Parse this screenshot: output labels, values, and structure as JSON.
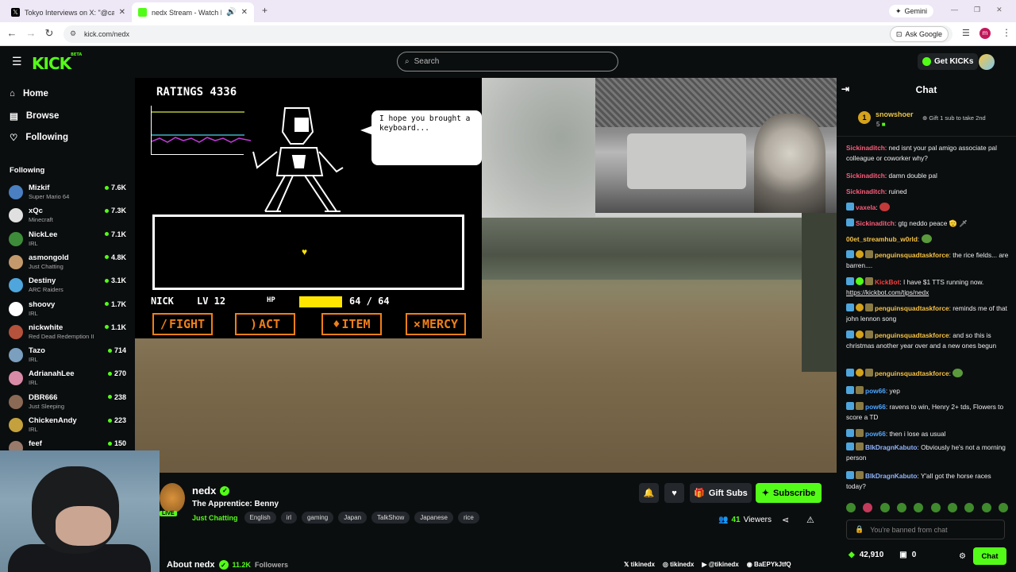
{
  "browser": {
    "tabs": [
      {
        "title": "Tokyo Interviews on X: \"@calli",
        "active": false
      },
      {
        "title": "nedx Stream - Watch Live o",
        "active": true
      }
    ],
    "new_tab": "+",
    "gemini": "Gemini",
    "url": "kick.com/nedx",
    "ask_google": "Ask Google",
    "profile_initial": "m"
  },
  "kick": {
    "logo": "KICK",
    "logo_badge": "BETA",
    "search_placeholder": "Search",
    "get_kicks": "Get KICKs",
    "brand_color": "#53fc18"
  },
  "sidebar": {
    "nav": [
      {
        "label": "Home",
        "icon": "home-icon"
      },
      {
        "label": "Browse",
        "icon": "browse-icon"
      },
      {
        "label": "Following",
        "icon": "heart-icon"
      }
    ],
    "following_title": "Following",
    "channels": [
      {
        "name": "Mizkif",
        "category": "Super Mario 64",
        "viewers": "7.6K",
        "color": "#4a7fc1"
      },
      {
        "name": "xQc",
        "category": "Minecraft",
        "viewers": "7.3K",
        "color": "#e0e0e0"
      },
      {
        "name": "NickLee",
        "category": "IRL",
        "viewers": "7.1K",
        "color": "#3d8c3a"
      },
      {
        "name": "asmongold",
        "category": "Just Chatting",
        "viewers": "4.8K",
        "color": "#c49a6c"
      },
      {
        "name": "Destiny",
        "category": "ARC Raiders",
        "viewers": "3.1K",
        "color": "#4ea6dc"
      },
      {
        "name": "shoovy",
        "category": "IRL",
        "viewers": "1.7K",
        "color": "#ffffff"
      },
      {
        "name": "nickwhite",
        "category": "Red Dead Redemption II",
        "viewers": "1.1K",
        "color": "#b5523c"
      },
      {
        "name": "Tazo",
        "category": "IRL",
        "viewers": "714",
        "color": "#7a9fbf"
      },
      {
        "name": "AdrianahLee",
        "category": "IRL",
        "viewers": "270",
        "color": "#d98aa6"
      },
      {
        "name": "DBR666",
        "category": "Just Sleeping",
        "viewers": "238",
        "color": "#8a6a55"
      },
      {
        "name": "ChickenAndy",
        "category": "IRL",
        "viewers": "223",
        "color": "#c4a13c"
      },
      {
        "name": "feef",
        "category": "",
        "viewers": "150",
        "color": "#9a7a6a"
      }
    ]
  },
  "game": {
    "ratings": "RATINGS 4336",
    "speech": "I hope you brought a keyboard...",
    "player_name": "NICK",
    "level": "LV 12",
    "hp_label": "HP",
    "hp_value": "64 / 64",
    "hp_fraction": 1.0,
    "buttons": [
      "FIGHT",
      "ACT",
      "ITEM",
      "MERCY"
    ]
  },
  "stream": {
    "channel_name": "nedx",
    "live_label": "LIVE",
    "title": "The Apprentice: Benny",
    "category": "Just Chatting",
    "tags": [
      "English",
      "irl",
      "gaming",
      "Japan",
      "TalkShow",
      "Japanese",
      "rice"
    ],
    "gift_subs": "Gift Subs",
    "subscribe": "Subscribe",
    "viewer_count": "41",
    "viewers_label": "Viewers",
    "about": "About nedx",
    "followers_count": "11.2K",
    "followers_label": "Followers",
    "socials": [
      "tikinedx",
      "tikinedx",
      "@tikinedx",
      "BaEPYkJtfQ"
    ]
  },
  "chat": {
    "title": "Chat",
    "pinned": {
      "rank": "1",
      "name": "snowshoer",
      "count": "5",
      "gift_text": "Gift 1 sub to take 2nd"
    },
    "messages": [
      {
        "user": "Sickinaditch",
        "color": "#ff5b7a",
        "text": "ned isnt your pal amigo associate pal colleague or coworker why?"
      },
      {
        "user": "Sickinaditch",
        "color": "#ff5b7a",
        "text": "damn double pal"
      },
      {
        "user": "Sickinaditch",
        "color": "#ff5b7a",
        "text": "ruined"
      },
      {
        "user": "vaxela",
        "color": "#ff5b7a",
        "text": ""
      },
      {
        "user": "Sickinaditch",
        "color": "#ff5b7a",
        "text": "gtg neddo peace 🫡 🗡"
      },
      {
        "user": "00et_streamhub_w0rld",
        "color": "#f6c244",
        "text": ""
      },
      {
        "user": "penguinsquadtaskforce",
        "color": "#f6c244",
        "text": "the rice fields... are barren...."
      },
      {
        "user": "KickBot",
        "color": "#ff3d3d",
        "text": "I have $1 TTS running now.",
        "link": "https://kickbot.com/tips/nedx"
      },
      {
        "user": "penguinsquadtaskforce",
        "color": "#f6c244",
        "text": "reminds me of that john lennon song"
      },
      {
        "user": "penguinsquadtaskforce",
        "color": "#f6c244",
        "text": "and so this is christmas another year over and a new ones begun"
      },
      {
        "user": "penguinsquadtaskforce",
        "color": "#f6c244",
        "text": ""
      },
      {
        "user": "pow66",
        "color": "#4ea6ff",
        "text": "yep"
      },
      {
        "user": "pow66",
        "color": "#4ea6ff",
        "text": "ravens to win, Henry 2+ tds, Flowers to score a TD"
      },
      {
        "user": "pow66",
        "color": "#4ea6ff",
        "text": "then i lose as usual"
      },
      {
        "user": "BlkDragnKabuto",
        "color": "#8fb4ff",
        "text": "Obviously he's not a morning person"
      },
      {
        "user": "BlkDragnKabuto",
        "color": "#8fb4ff",
        "text": "Y'all got the horse races today?"
      }
    ],
    "banned_placeholder": "You're banned from chat",
    "points": "42,910",
    "zero_count": "0",
    "chat_button": "Chat"
  }
}
